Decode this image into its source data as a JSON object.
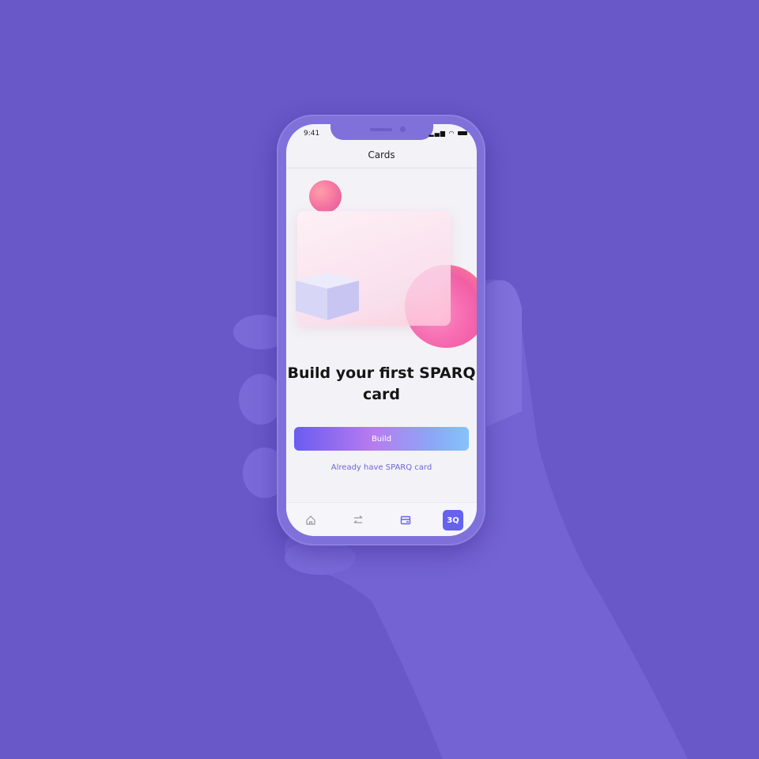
{
  "background_color": "#6858c8",
  "status_bar": {
    "time": "9:41",
    "icons": [
      "signal-icon",
      "wifi-icon",
      "battery-icon"
    ]
  },
  "header": {
    "title": "Cards"
  },
  "main": {
    "headline": "Build your first SPARQ card",
    "build_label": "Build",
    "secondary_link": "Already have SPARQ card",
    "accent_color": "#6661ef"
  },
  "tab_bar": {
    "items": [
      {
        "icon": "home-icon"
      },
      {
        "icon": "transfer-arrows-icon"
      },
      {
        "icon": "card-icon"
      },
      {
        "icon": "profile-initials",
        "label": "3Q",
        "active": true
      }
    ]
  }
}
